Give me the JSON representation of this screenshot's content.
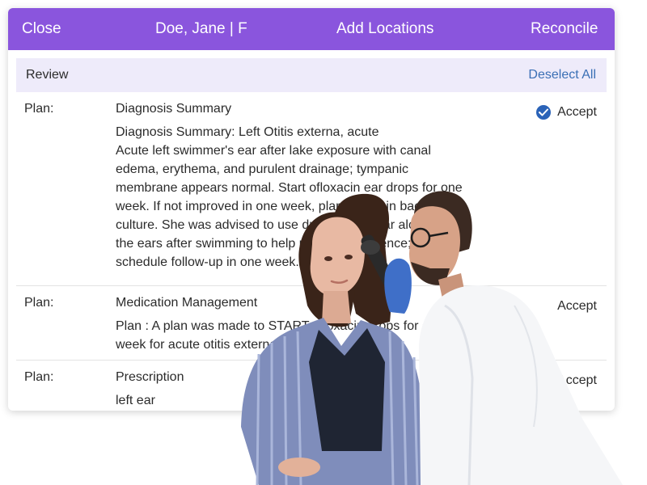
{
  "topbar": {
    "close_label": "Close",
    "patient_label": "Doe, Jane | F",
    "add_locations_label": "Add Locations",
    "reconcile_label": "Reconcile"
  },
  "review": {
    "title": "Review",
    "deselect_all_label": "Deselect All"
  },
  "rows": [
    {
      "label": "Plan:",
      "title": "Diagnosis Summary",
      "lines": [
        "Diagnosis Summary: Left Otitis externa, acute",
        "Acute left swimmer's ear after lake exposure with canal",
        "edema, erythema, and purulent drainage; tympanic",
        "membrane appears normal. Start ofloxacin ear drops for one",
        "week. If not improved in one week, plan to obtain bacterial",
        "culture. She was advised to use drops of vinegar alcohol in",
        "the ears after swimming to help prevent recurrence;",
        "schedule follow-up in one week."
      ],
      "accept_label": "Accept",
      "accepted": true
    },
    {
      "label": "Plan:",
      "title": "Medication Management",
      "lines": [
        "Plan : A plan was made to START ofloxacin drops for one",
        "week for acute otitis externa."
      ],
      "accept_label": "Accept",
      "accepted": false
    },
    {
      "label": "Plan:",
      "title": "Prescription",
      "lines": [
        "left ear"
      ],
      "accept_label": "Accept",
      "accepted": false
    }
  ],
  "colors": {
    "header_purple": "#8a55dd",
    "review_bg": "#eeebfa",
    "link_blue": "#3a6fb5",
    "check_blue": "#2b63b8"
  },
  "icons": {
    "accept_check": "check-circle-icon"
  },
  "photo": {
    "subject": "clinician-examining-patient-ear-photo"
  }
}
